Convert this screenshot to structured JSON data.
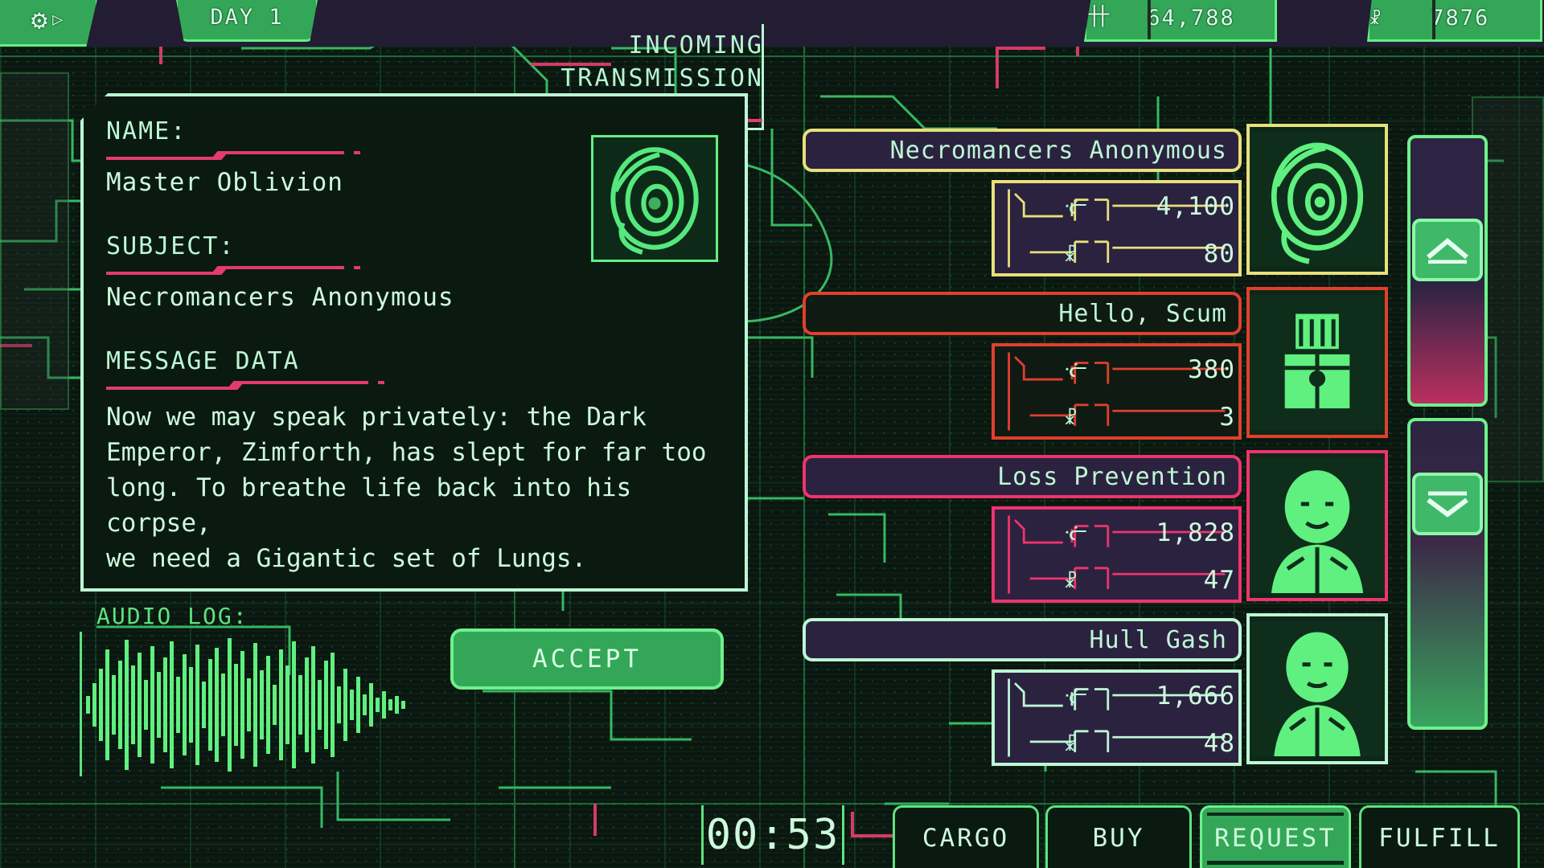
{
  "topbar": {
    "settings_icon": "gear-icon",
    "day_label": "DAY 1",
    "credits_icon": "credits-icon",
    "credits_value": "64,788",
    "reputation_icon": "chalice-icon",
    "reputation_value": "7876"
  },
  "transmission": {
    "heading_line1": "INCOMING",
    "heading_line2": "TRANSMISSION"
  },
  "message": {
    "name_label": "NAME:",
    "name_value": "Master Oblivion",
    "subject_label": "SUBJECT:",
    "subject_value": "Necromancers Anonymous",
    "data_label": "MESSAGE DATA",
    "body_line1": "Now we may speak privately: the Dark",
    "body_line2": "Emperor, Zimforth, has slept for far too",
    "body_line3": "long. To breathe life back into his corpse,",
    "body_line4": "we need a Gigantic set of Lungs."
  },
  "audio": {
    "label": "AUDIO LOG:"
  },
  "accept": {
    "label": "ACCEPT"
  },
  "cards": [
    {
      "title": "Necromancers Anonymous",
      "accent": "#e8e07a",
      "credits_icon": "credits-icon",
      "credits_value": "4,100",
      "reputation_icon": "chalice-icon",
      "reputation_value": "80",
      "selected": true
    },
    {
      "title": "Hello, Scum",
      "accent": "#e0402c",
      "credits_icon": "credits-icon",
      "credits_value": "380",
      "reputation_icon": "chalice-icon",
      "reputation_value": "3",
      "selected": false
    },
    {
      "title": "Loss Prevention",
      "accent": "#f0336e",
      "credits_icon": "credits-icon",
      "credits_value": "1,828",
      "reputation_icon": "chalice-icon",
      "reputation_value": "47",
      "selected": false
    },
    {
      "title": "Hull Gash",
      "accent": "#bdf7d4",
      "credits_icon": "credits-icon",
      "credits_value": "1,666",
      "reputation_icon": "chalice-icon",
      "reputation_value": "48",
      "selected": false
    }
  ],
  "scroll": {
    "up_icon": "chevron-up-icon",
    "down_icon": "chevron-down-icon"
  },
  "bottom": {
    "timer": "00:53",
    "cargo_label": "CARGO",
    "buy_label": "BUY",
    "request_label": "REQUEST",
    "fulfill_label": "FULFILL"
  },
  "colors": {
    "bg": "#0b1610",
    "green": "#5ee27f",
    "mint": "#bdf7d4",
    "pink": "#e33b6e",
    "panel": "#2b2240",
    "button_green": "#33a757"
  }
}
